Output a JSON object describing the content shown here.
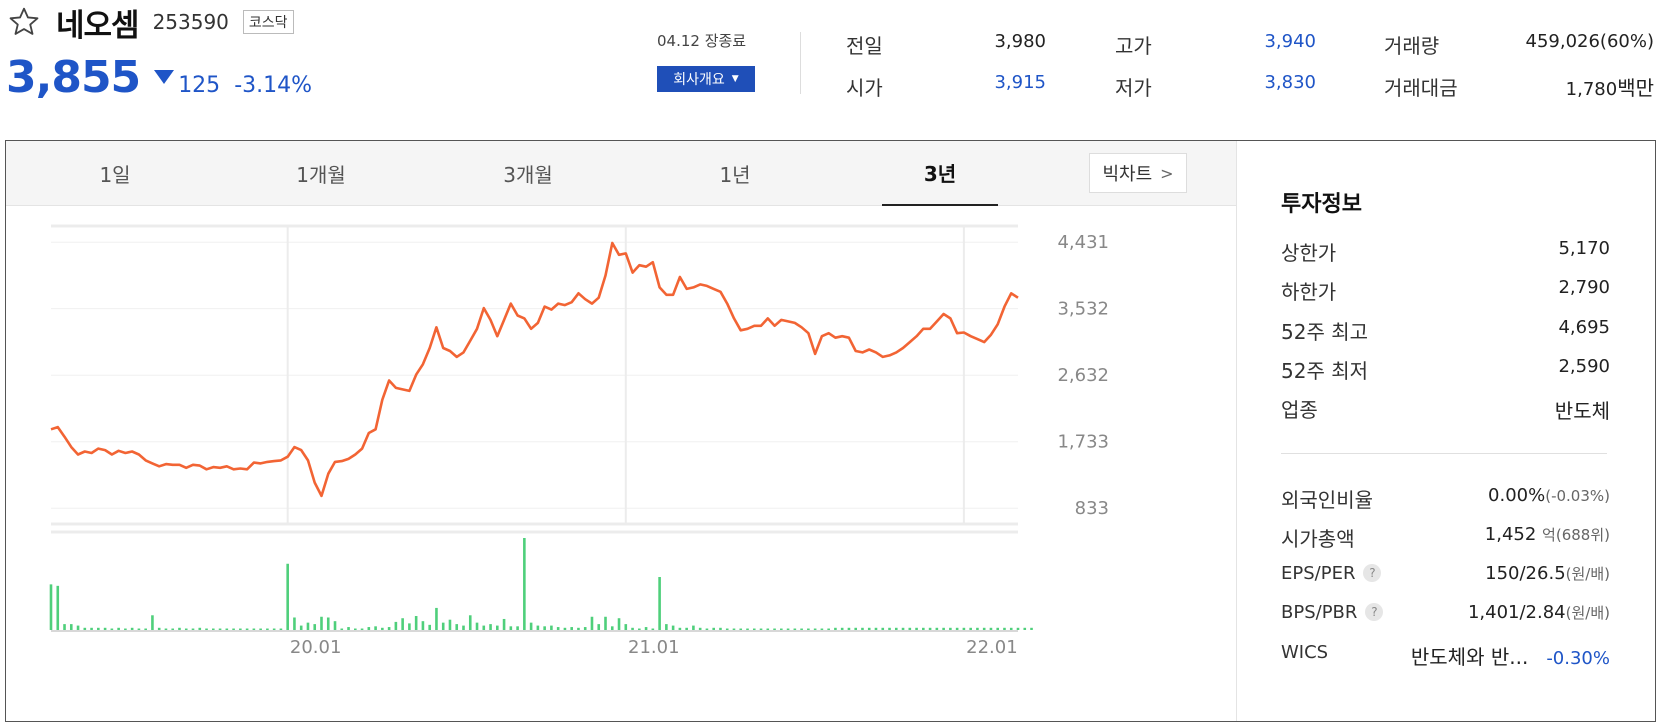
{
  "header": {
    "name": "네오셈",
    "code": "253590",
    "market": "코스닥",
    "price": "3,855",
    "change": "125",
    "change_rate": "-3.14%",
    "session": "04.12 장종료",
    "company_btn": "회사개요"
  },
  "quote": {
    "prev_label": "전일",
    "prev": "3,980",
    "open_label": "시가",
    "open": "3,915",
    "high_label": "고가",
    "high": "3,940",
    "low_label": "저가",
    "low": "3,830",
    "volume_label": "거래량",
    "volume": "459,026(60%)",
    "amount_label": "거래대금",
    "amount": "1,780",
    "amount_unit": "백만"
  },
  "tabs": [
    {
      "label": "1일"
    },
    {
      "label": "1개월"
    },
    {
      "label": "3개월"
    },
    {
      "label": "1년"
    },
    {
      "label": "3년",
      "active": true
    }
  ],
  "bigchart": "빅차트",
  "chart_data": {
    "type": "line",
    "y_ticks": [
      "4,431",
      "3,532",
      "2,632",
      "1,733",
      "833"
    ],
    "y_tick_values": [
      4431,
      3532,
      2632,
      1733,
      833
    ],
    "x_ticks": [
      "20.01",
      "21.01",
      "22.01"
    ],
    "x_tick_index": [
      35,
      85,
      135
    ],
    "ylim": [
      620,
      4650
    ],
    "price": [
      1900,
      1930,
      1800,
      1660,
      1560,
      1600,
      1580,
      1640,
      1620,
      1560,
      1610,
      1580,
      1600,
      1560,
      1480,
      1440,
      1400,
      1430,
      1420,
      1420,
      1380,
      1420,
      1410,
      1360,
      1390,
      1380,
      1400,
      1360,
      1370,
      1360,
      1450,
      1440,
      1460,
      1470,
      1480,
      1530,
      1660,
      1620,
      1480,
      1180,
      1000,
      1300,
      1460,
      1470,
      1500,
      1560,
      1640,
      1850,
      1900,
      2300,
      2560,
      2460,
      2440,
      2420,
      2640,
      2780,
      3000,
      3280,
      3000,
      2960,
      2880,
      2940,
      3100,
      3260,
      3540,
      3380,
      3160,
      3380,
      3600,
      3440,
      3400,
      3260,
      3340,
      3560,
      3520,
      3600,
      3580,
      3620,
      3740,
      3660,
      3600,
      3680,
      3980,
      4420,
      4260,
      4280,
      4020,
      4120,
      4100,
      4160,
      3820,
      3720,
      3720,
      3960,
      3800,
      3820,
      3860,
      3840,
      3800,
      3760,
      3600,
      3400,
      3240,
      3260,
      3300,
      3300,
      3400,
      3300,
      3380,
      3360,
      3340,
      3280,
      3200,
      2920,
      3160,
      3200,
      3140,
      3160,
      3140,
      2960,
      2940,
      2980,
      2940,
      2880,
      2900,
      2940,
      3000,
      3080,
      3160,
      3260,
      3260,
      3360,
      3460,
      3400,
      3200,
      3210,
      3160,
      3120,
      3080,
      3180,
      3320,
      3560,
      3740,
      3680
    ],
    "volume": [
      62,
      60,
      8,
      8,
      6,
      3,
      3,
      3,
      3,
      2,
      3,
      2,
      3,
      2,
      2,
      20,
      3,
      2,
      2,
      3,
      2,
      2,
      3,
      2,
      2,
      2,
      2,
      2,
      2,
      2,
      2,
      2,
      2,
      2,
      2,
      90,
      17,
      6,
      10,
      8,
      18,
      17,
      12,
      2,
      4,
      2,
      2,
      4,
      5,
      3,
      4,
      11,
      16,
      9,
      19,
      12,
      7,
      30,
      10,
      14,
      8,
      6,
      20,
      10,
      6,
      8,
      6,
      15,
      5,
      5,
      125,
      10,
      6,
      5,
      6,
      4,
      3,
      4,
      3,
      4,
      18,
      8,
      18,
      5,
      16,
      8,
      3,
      2,
      4,
      2,
      72,
      8,
      6,
      3,
      3,
      6,
      3,
      2,
      3,
      3,
      2,
      2,
      2,
      2,
      2,
      2,
      2,
      2,
      2,
      2,
      2,
      2,
      2,
      2,
      2,
      2,
      3,
      3,
      3,
      3,
      3,
      3,
      3,
      3,
      3,
      3,
      3,
      3,
      3,
      3,
      3,
      3,
      3,
      3,
      3,
      3,
      3,
      3,
      3,
      3,
      3,
      3,
      3,
      3,
      3,
      3
    ],
    "line_color": "#f26434",
    "volume_color": "#4fcf7b"
  },
  "invest": {
    "title": "투자정보",
    "upper_label": "상한가",
    "upper": "5,170",
    "lower_label": "하한가",
    "lower": "2,790",
    "high52_label": "52주 최고",
    "high52": "4,695",
    "low52_label": "52주 최저",
    "low52": "2,590",
    "sector_label": "업종",
    "sector": "반도체",
    "foreign_label": "외국인비율",
    "foreign": "0.00%",
    "foreign_chg": "(-0.03%)",
    "mcap_label": "시가총액",
    "mcap": "1,452",
    "mcap_unit": "억",
    "mcap_rank": "(688위)",
    "eps_label": "EPS/PER",
    "eps": "150/26.5",
    "eps_unit": "(원/배)",
    "bps_label": "BPS/PBR",
    "bps": "1,401/2.84",
    "bps_unit": "(원/배)",
    "wics_label": "WICS",
    "wics": "반도체와 반...",
    "wics_chg": "-0.30%"
  }
}
